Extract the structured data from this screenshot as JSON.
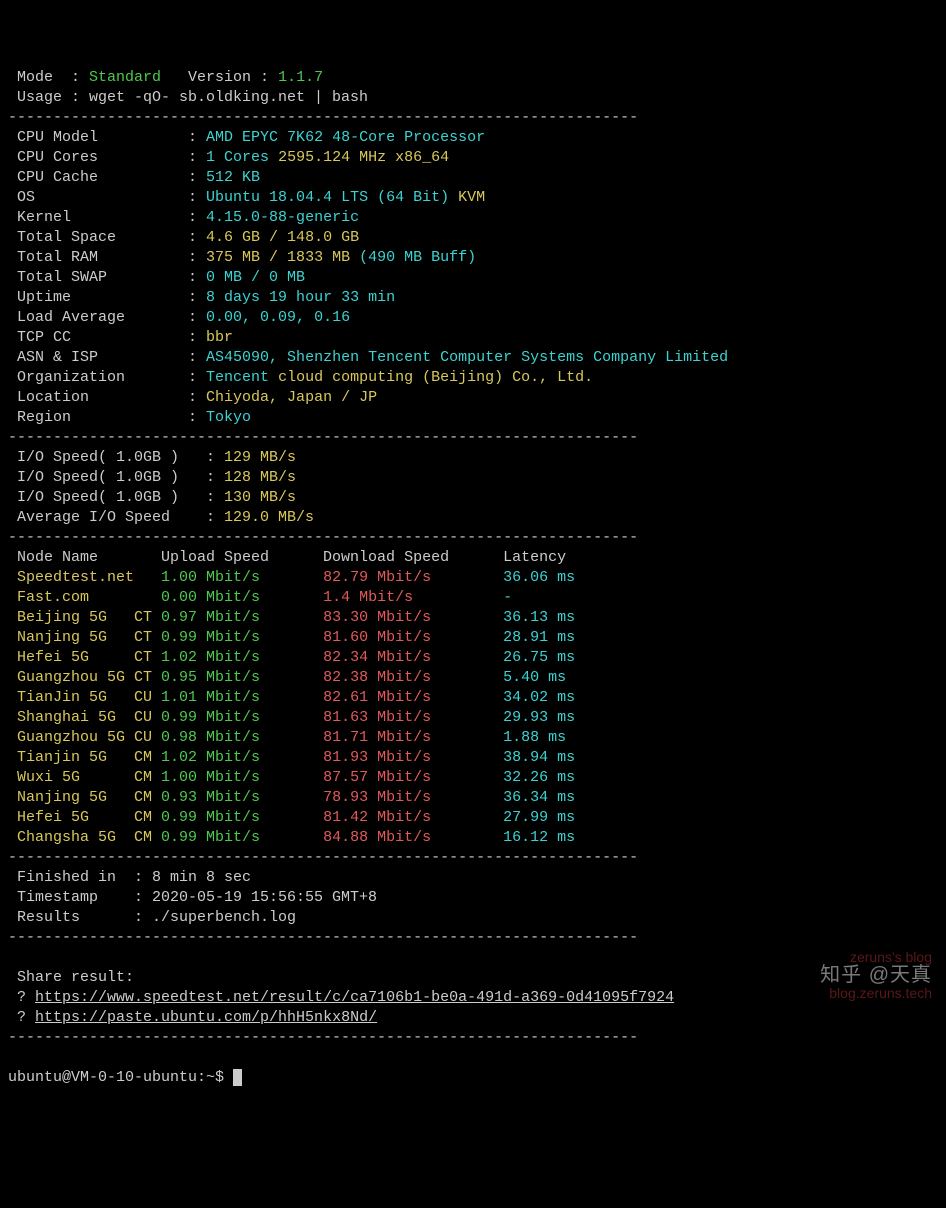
{
  "header": {
    "mode_label": " Mode  : ",
    "mode_value": "Standard",
    "version_label": "   Version : ",
    "version_value": "1.1.7",
    "usage": " Usage : wget -qO- sb.oldking.net | bash"
  },
  "dash": "----------------------------------------------------------------------",
  "sys": [
    {
      "label": " CPU Model          : ",
      "val": "AMD EPYC 7K62 48-Core Processor",
      "cls": "c"
    },
    {
      "label": " CPU Cores          : ",
      "val": "1 Cores",
      "cls": "c",
      "extra": " 2595.124 MHz x86_64",
      "extra_cls": "y"
    },
    {
      "label": " CPU Cache          : ",
      "val": "512 KB",
      "cls": "c"
    },
    {
      "label": " OS                 : ",
      "val": "Ubuntu 18.04.4 LTS (64 Bit)",
      "cls": "c",
      "extra": " KVM",
      "extra_cls": "y"
    },
    {
      "label": " Kernel             : ",
      "val": "4.15.0-88-generic",
      "cls": "c"
    },
    {
      "label": " Total Space        : ",
      "val": "4.6 GB / 148.0 GB",
      "cls": "y"
    },
    {
      "label": " Total RAM          : ",
      "val": "375 MB / 1833 MB",
      "cls": "y",
      "extra": " (490 MB Buff)",
      "extra_cls": "c"
    },
    {
      "label": " Total SWAP         : ",
      "val": "0 MB / 0 MB",
      "cls": "c"
    },
    {
      "label": " Uptime             : ",
      "val": "8 days 19 hour 33 min",
      "cls": "c"
    },
    {
      "label": " Load Average       : ",
      "val": "0.00, 0.09, 0.16",
      "cls": "c"
    },
    {
      "label": " TCP CC             : ",
      "val": "bbr",
      "cls": "y"
    },
    {
      "label": " ASN & ISP          : ",
      "val": "AS45090, Shenzhen Tencent Computer Systems Company Limited",
      "cls": "c"
    },
    {
      "label": " Organization       : ",
      "val": "Tencent",
      "cls": "c",
      "extra": " cloud computing (Beijing) Co., Ltd.",
      "extra_cls": "y"
    },
    {
      "label": " Location           : ",
      "val": "Chiyoda, Japan / JP",
      "cls": "y"
    },
    {
      "label": " Region             : ",
      "val": "Tokyo",
      "cls": "c"
    }
  ],
  "io": [
    {
      "label": " I/O Speed( 1.0GB )   : ",
      "val": "129 MB/s"
    },
    {
      "label": " I/O Speed( 1.0GB )   : ",
      "val": "128 MB/s"
    },
    {
      "label": " I/O Speed( 1.0GB )   : ",
      "val": "130 MB/s"
    },
    {
      "label": " Average I/O Speed    : ",
      "val": "129.0 MB/s"
    }
  ],
  "speed_header": " Node Name       Upload Speed      Download Speed      Latency     ",
  "speedtest": [
    {
      "node": " Speedtest.net   ",
      "up": "1.00 Mbit/s       ",
      "down": "82.79 Mbit/s        ",
      "lat": "36.06 ms"
    },
    {
      "node": " Fast.com        ",
      "up": "0.00 Mbit/s       ",
      "down": "1.4 Mbit/s          ",
      "lat": "-"
    },
    {
      "node": " Beijing 5G   CT ",
      "up": "0.97 Mbit/s       ",
      "down": "83.30 Mbit/s        ",
      "lat": "36.13 ms"
    },
    {
      "node": " Nanjing 5G   CT ",
      "up": "0.99 Mbit/s       ",
      "down": "81.60 Mbit/s        ",
      "lat": "28.91 ms"
    },
    {
      "node": " Hefei 5G     CT ",
      "up": "1.02 Mbit/s       ",
      "down": "82.34 Mbit/s        ",
      "lat": "26.75 ms"
    },
    {
      "node": " Guangzhou 5G CT ",
      "up": "0.95 Mbit/s       ",
      "down": "82.38 Mbit/s        ",
      "lat": "5.40 ms"
    },
    {
      "node": " TianJin 5G   CU ",
      "up": "1.01 Mbit/s       ",
      "down": "82.61 Mbit/s        ",
      "lat": "34.02 ms"
    },
    {
      "node": " Shanghai 5G  CU ",
      "up": "0.99 Mbit/s       ",
      "down": "81.63 Mbit/s        ",
      "lat": "29.93 ms"
    },
    {
      "node": " Guangzhou 5G CU ",
      "up": "0.98 Mbit/s       ",
      "down": "81.71 Mbit/s        ",
      "lat": "1.88 ms"
    },
    {
      "node": " Tianjin 5G   CM ",
      "up": "1.02 Mbit/s       ",
      "down": "81.93 Mbit/s        ",
      "lat": "38.94 ms"
    },
    {
      "node": " Wuxi 5G      CM ",
      "up": "1.00 Mbit/s       ",
      "down": "87.57 Mbit/s        ",
      "lat": "32.26 ms"
    },
    {
      "node": " Nanjing 5G   CM ",
      "up": "0.93 Mbit/s       ",
      "down": "78.93 Mbit/s        ",
      "lat": "36.34 ms"
    },
    {
      "node": " Hefei 5G     CM ",
      "up": "0.99 Mbit/s       ",
      "down": "81.42 Mbit/s        ",
      "lat": "27.99 ms"
    },
    {
      "node": " Changsha 5G  CM ",
      "up": "0.99 Mbit/s       ",
      "down": "84.88 Mbit/s        ",
      "lat": "16.12 ms"
    }
  ],
  "summary": {
    "finished": " Finished in  : 8 min 8 sec",
    "timestamp": " Timestamp    : 2020-05-19 15:56:55 GMT+8",
    "results": " Results      : ./superbench.log"
  },
  "share": {
    "title": " Share result:",
    "prefix": " ? ",
    "link1": "https://www.speedtest.net/result/c/ca7106b1-be0a-491d-a369-0d41095f7924",
    "link2": "https://paste.ubuntu.com/p/hhH5nkx8Nd/"
  },
  "prompt": "ubuntu@VM-0-10-ubuntu:~$ ",
  "watermark": {
    "l1": "zeruns's blog",
    "l2": "知乎 @天真",
    "l3": "blog.zeruns.tech"
  }
}
